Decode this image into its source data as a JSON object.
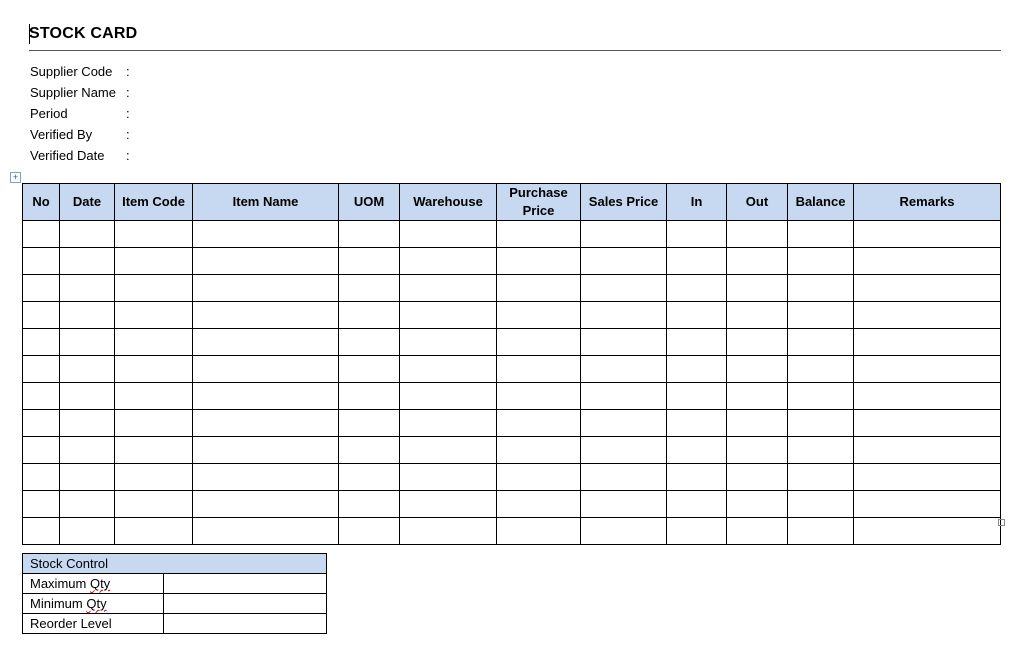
{
  "title": "STOCK CARD",
  "fields": [
    {
      "label": "Supplier Code",
      "value": ""
    },
    {
      "label": "Supplier Name",
      "value": ""
    },
    {
      "label": "Period",
      "value": ""
    },
    {
      "label": "Verified By",
      "value": ""
    },
    {
      "label": "Verified Date",
      "value": ""
    }
  ],
  "table": {
    "columns": [
      "No",
      "Date",
      "Item Code",
      "Item Name",
      "UOM",
      "Warehouse",
      "Purchase Price",
      "Sales Price",
      "In",
      "Out",
      "Balance",
      "Remarks"
    ],
    "empty_rows": 12
  },
  "stock_control": {
    "header": "Stock Control",
    "rows": [
      {
        "label": "Maximum Qty",
        "value": ""
      },
      {
        "label": "Minimum Qty",
        "value": ""
      },
      {
        "label": "Reorder Level",
        "value": ""
      }
    ]
  },
  "colors": {
    "header_fill": "#c6d9f1"
  }
}
